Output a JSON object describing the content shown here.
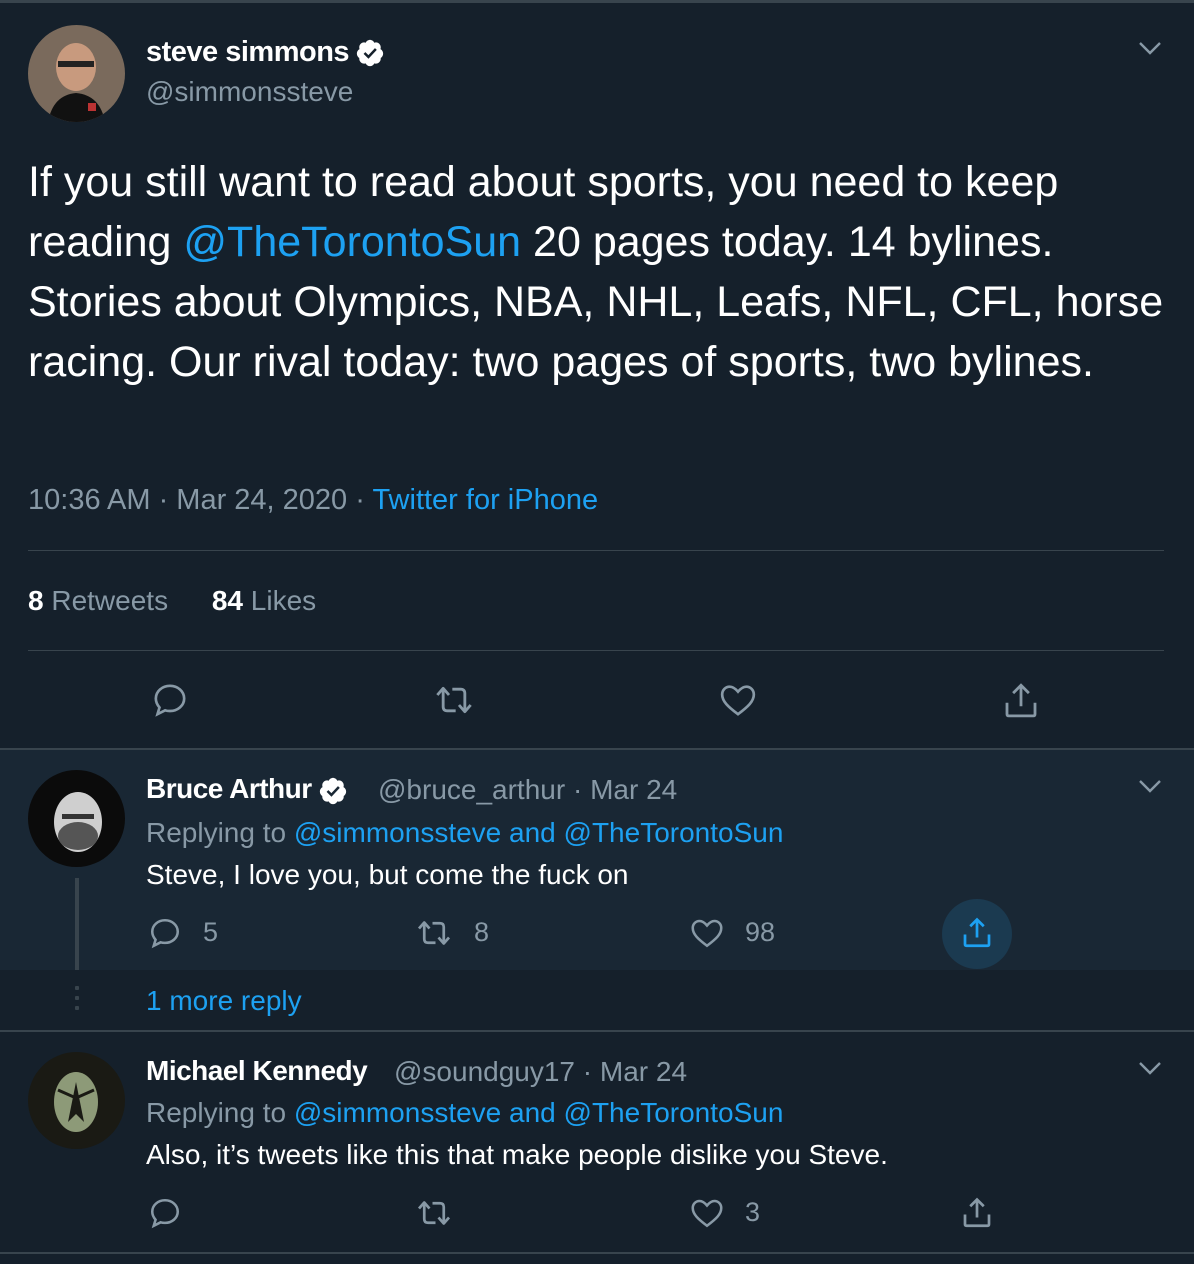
{
  "main_tweet": {
    "author_name": "steve simmons",
    "author_handle": "@simmonssteve",
    "text_before_mention": "If you still want to read about sports, you need to keep reading ",
    "mention": "@TheTorontoSun",
    "text_after_mention": " 20 pages today. 14 bylines. Stories about Olympics, NBA, NHL, Leafs, NFL, CFL, horse racing. Our rival today: two pages of sports, two bylines.",
    "time": "10:36 AM · Mar 24, 2020 · ",
    "source": "Twitter for iPhone",
    "retweets_count": "8",
    "retweets_label": " Retweets",
    "likes_count": "84",
    "likes_label": " Likes"
  },
  "replies": [
    {
      "author_name": "Bruce Arthur",
      "verified": true,
      "handle_date": "@bruce_arthur · Mar 24",
      "replying_prefix": "Replying to ",
      "replying_to_1": "@simmonssteve",
      "replying_and": " and ",
      "replying_to_2": "@TheTorontoSun",
      "text": "Steve, I love you, but come the fuck on",
      "reply_count": "5",
      "retweet_count": "8",
      "like_count": "98"
    },
    {
      "author_name": "Michael Kennedy",
      "verified": false,
      "handle_date": "@soundguy17 · Mar 24",
      "replying_prefix": "Replying to ",
      "replying_to_1": "@simmonssteve",
      "replying_and": " and ",
      "replying_to_2": "@TheTorontoSun",
      "text": "Also, it’s tweets like this that make people dislike you Steve.",
      "reply_count": "",
      "retweet_count": "",
      "like_count": "3"
    }
  ],
  "more_replies_label": "1 more reply",
  "colors": {
    "background": "#15202b",
    "highlight_background": "#192734",
    "accent": "#1da1f2",
    "muted": "#8899a6",
    "divider": "#38444d"
  },
  "icons": [
    "chevron-down-icon",
    "verified-badge-icon",
    "reply-icon",
    "retweet-icon",
    "like-icon",
    "share-icon"
  ]
}
